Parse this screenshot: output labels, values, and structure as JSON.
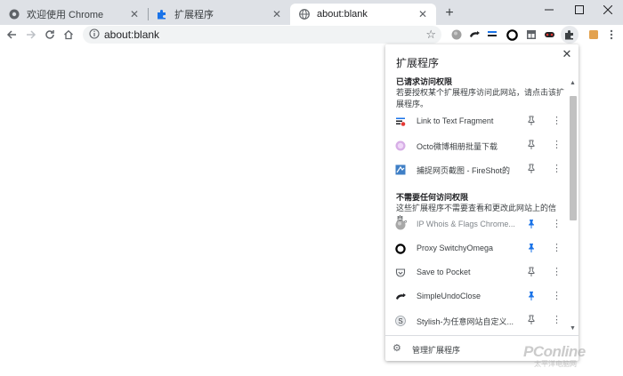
{
  "tabs": [
    {
      "title": "欢迎使用 Chrome",
      "icon": "chrome-icon",
      "active": false
    },
    {
      "title": "扩展程序",
      "icon": "puzzle-icon",
      "active": false
    },
    {
      "title": "about:blank",
      "icon": "globe-icon",
      "active": true
    }
  ],
  "toolbar": {
    "url": "about:blank",
    "extension_icons": [
      "ip-whois-icon",
      "simple-undo-close-icon",
      "link-to-text-fragment-icon",
      "proxy-switchyomega-icon",
      "fireshot-icon",
      "octo-icon",
      "pinned-extension-icon"
    ]
  },
  "popup": {
    "title": "扩展程序",
    "sections": [
      {
        "title": "已请求访问权限",
        "description": "若要授权某个扩展程序访问此网站，请点击该扩展程序。",
        "items": [
          {
            "name": "Link to Text Fragment",
            "icon": "link-to-text-fragment-icon",
            "pinned": false
          },
          {
            "name": "Octo微博相册批量下载",
            "icon": "octo-icon",
            "pinned": false
          },
          {
            "name": "捕捉网页截图 - FireShot的",
            "icon": "fireshot-icon",
            "pinned": false
          }
        ]
      },
      {
        "title": "不需要任何访问权限",
        "description": "这些扩展程序不需要查看和更改此网站上的信息。",
        "items": [
          {
            "name": "IP Whois & Flags Chrome...",
            "icon": "ip-whois-icon",
            "pinned": true
          },
          {
            "name": "Proxy SwitchyOmega",
            "icon": "proxy-switchyomega-icon",
            "pinned": true
          },
          {
            "name": "Save to Pocket",
            "icon": "pocket-icon",
            "pinned": false
          },
          {
            "name": "SimpleUndoClose",
            "icon": "simple-undo-close-icon",
            "pinned": true
          },
          {
            "name": "Stylish-为任意网站自定义...",
            "icon": "stylish-icon",
            "pinned": false
          }
        ]
      }
    ],
    "footer_label": "管理扩展程序"
  },
  "watermark": {
    "brand": "PConline",
    "sub": "太平洋电脑网"
  },
  "colors": {
    "accent": "#1a73e8",
    "tabbar": "#dee1e6",
    "popup_bg": "#ffffff"
  }
}
